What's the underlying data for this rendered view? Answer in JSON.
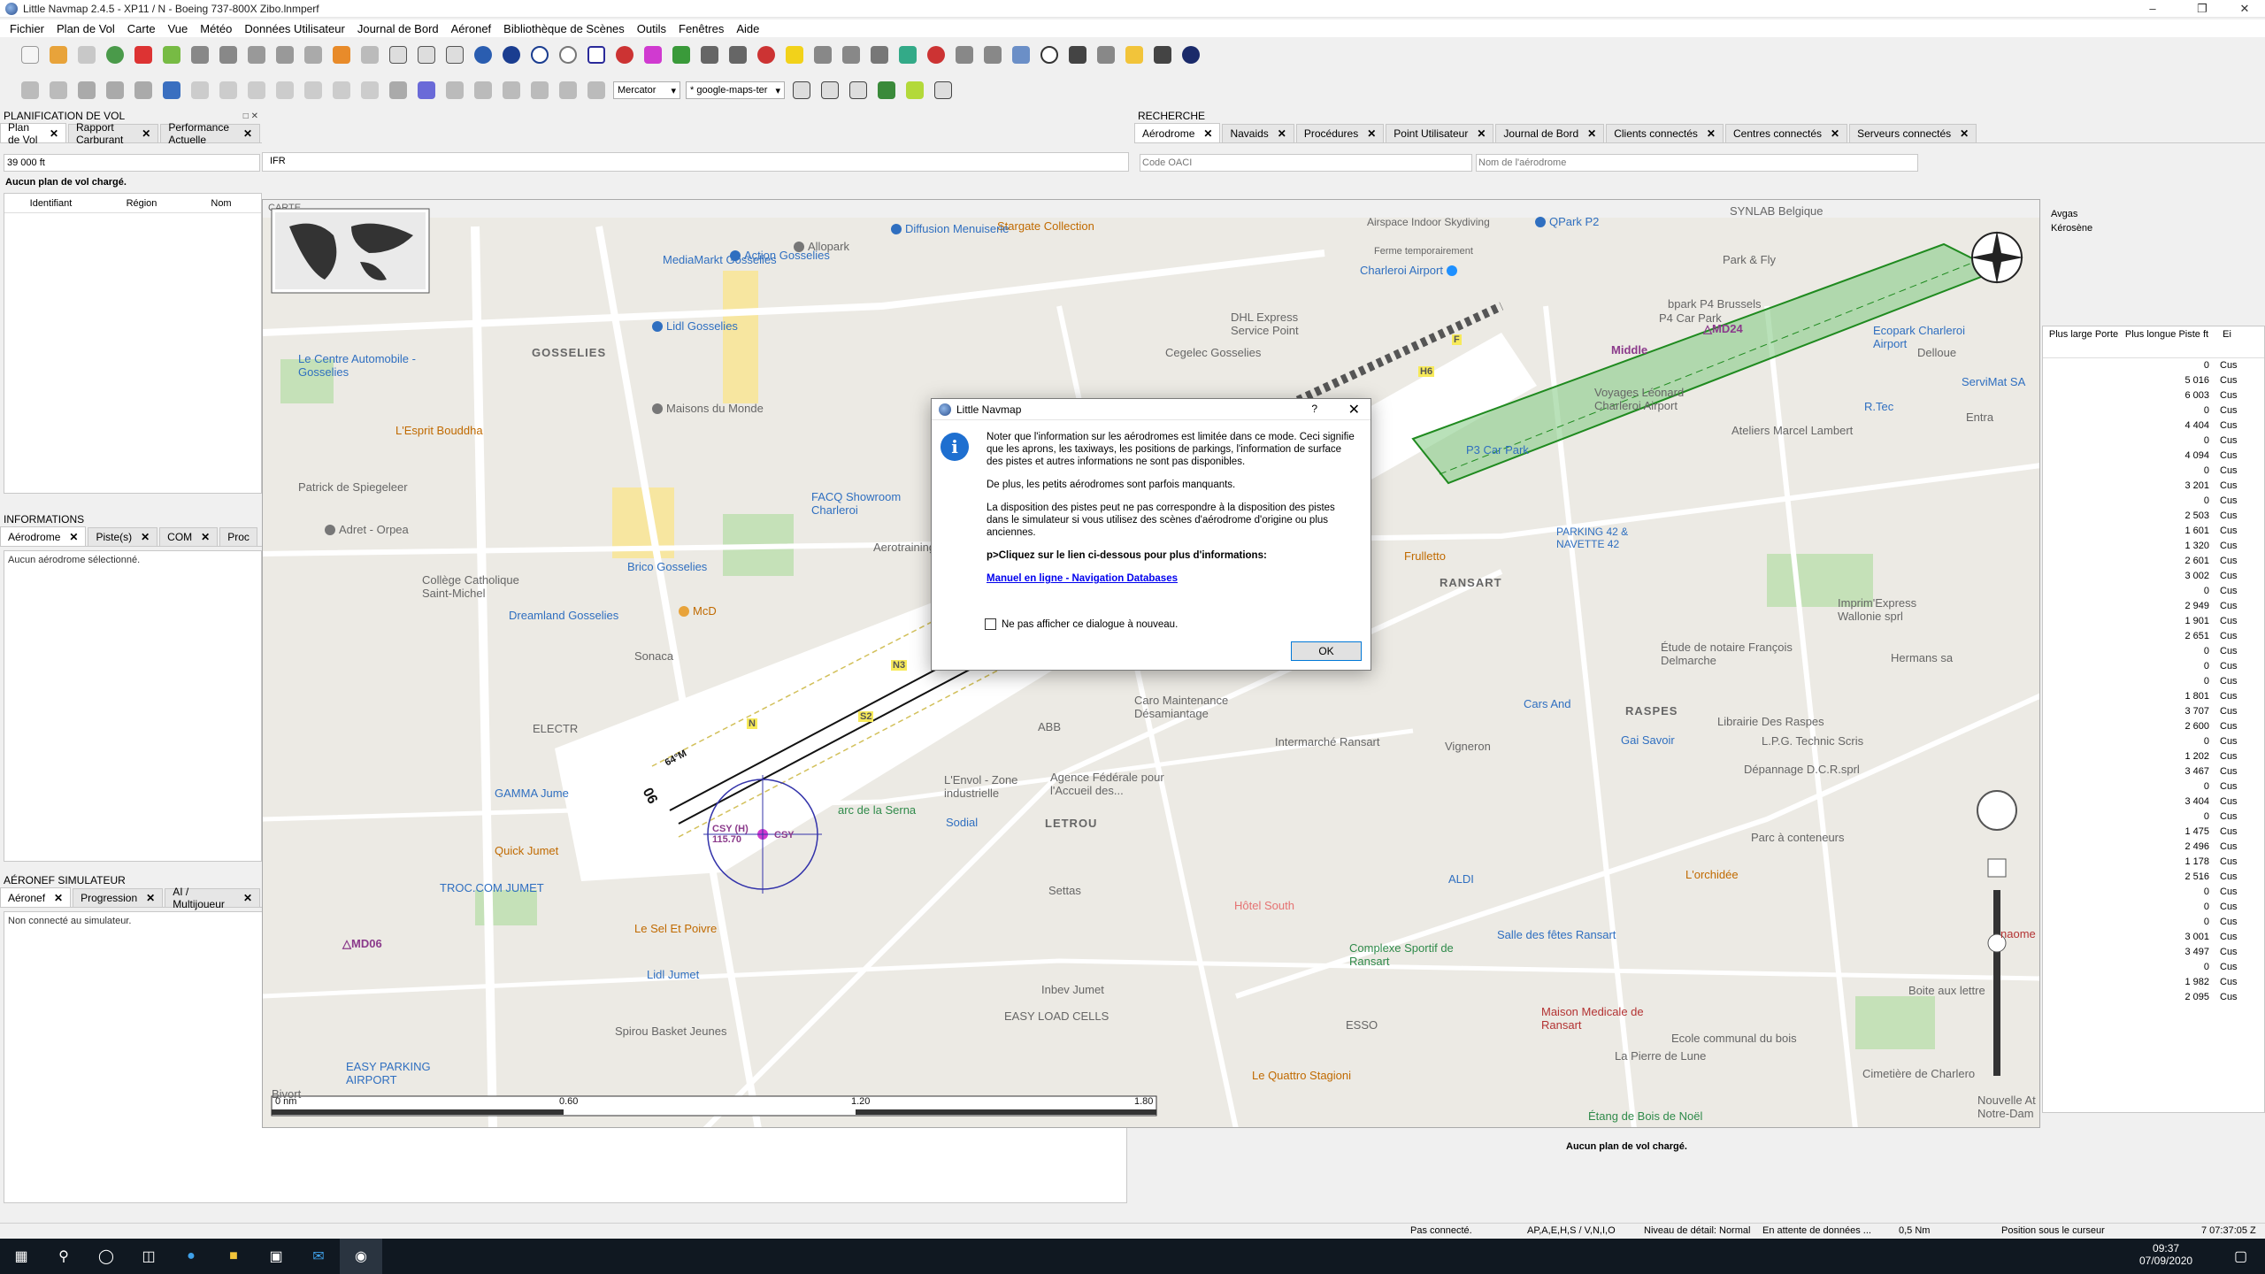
{
  "window": {
    "title": "Little Navmap 2.4.5 - XP11 / N - Boeing 737-800X Zibo.lnmperf"
  },
  "menu": [
    "Fichier",
    "Plan de Vol",
    "Carte",
    "Vue",
    "Météo",
    "Données Utilisateur",
    "Journal de Bord",
    "Aéronef",
    "Bibliothèque de Scènes",
    "Outils",
    "Fenêtres",
    "Aide"
  ],
  "toolbar": {
    "projection": "Mercator",
    "theme": "* google-maps-ter"
  },
  "flight_plan": {
    "title": "PLANIFICATION DE VOL",
    "tabs": [
      "Plan de Vol",
      "Rapport Carburant",
      "Performance Actuelle"
    ],
    "altitude": "39 000 ft",
    "type": "IFR",
    "no_plan": "Aucun plan de vol chargé.",
    "columns": [
      "Identifiant",
      "Région",
      "Nom"
    ]
  },
  "informations": {
    "title": "INFORMATIONS",
    "tabs": [
      "Aérodrome",
      "Piste(s)",
      "COM",
      "Proc"
    ],
    "empty": "Aucun aérodrome sélectionné."
  },
  "aircraft": {
    "title": "AÉRONEF SIMULATEUR",
    "tabs": [
      "Aéronef",
      "Progression",
      "AI / Multijoueur"
    ],
    "status": "Non connecté au simulateur."
  },
  "map": {
    "title": "CARTE",
    "scale_labels": [
      "0 nm",
      "0.60",
      "1.20",
      "1.80"
    ],
    "places": {
      "allopark": "Allopark",
      "action_gosselies": "Action Gosselies",
      "stargate": "Stargate Collection",
      "airspace": "Airspace Indoor Skydiving",
      "airspace_sub": "Ferme temporairement",
      "qpark": "QPark P2",
      "synlab": "SYNLAB Belgique",
      "diffusion": "Diffusion Menuiserie",
      "mediamarkt": "MediaMarkt Gosselies",
      "charleroi_airport": "Charleroi Airport",
      "bpark": "bpark P4 Brussels",
      "p4car": "P4 Car Park",
      "parkfly": "Park & Fly",
      "ecopark": "Ecopark Charleroi Airport",
      "delloue": "Delloue",
      "dhl": "DHL Express Service Point",
      "cegelec": "Cegelec Gosselies",
      "lidl_gosselies": "Lidl Gosselies",
      "gosselies": "GOSSELIES",
      "centre_auto": "Le Centre Automobile - Gosselies",
      "maisons_monde": "Maisons du Monde",
      "voyages": "Voyages Léonard Charleroi Airport",
      "ateliers": "Ateliers Marcel Lambert",
      "rtec": "R.Tec",
      "entra": "Entra",
      "servimat": "ServiMat SA",
      "esprit": "L'Esprit Bouddha",
      "p3car": "P3 Car Park",
      "patrick": "Patrick de Spiegeleer",
      "facq": "FACQ Showroom Charleroi",
      "aerotraining": "Aerotraining Netw",
      "adret": "Adret - Orpea",
      "brico": "Brico Gosselies",
      "college": "Collège Catholique Saint-Michel",
      "dreamland": "Dreamland Gosselies",
      "mcd": "McD",
      "sonaca": "Sonaca",
      "frulletto": "Frulletto",
      "parking42": "PARKING 42 & NAVETTE 42",
      "ransart": "RANSART",
      "imprim": "Imprim'Express Wallonie sprl",
      "etude": "Étude de notaire François Delmarche",
      "hermans": "Hermans sa",
      "electr": "ELECTR",
      "caro": "Caro Maintenance Désamiantage",
      "abb": "ABB",
      "cars_and": "Cars And",
      "raspes": "RASPES",
      "librairie": "Librairie Des Raspes",
      "intermarche": "Intermarché Ransart",
      "vigneron": "Vigneron",
      "gai_savoir": "Gai Savoir",
      "lpg": "L.P.G. Technic Scris",
      "depannage": "Dépannage D.C.R.sprl",
      "gamma": "GAMMA Jume",
      "lenvol": "L'Envol - Zone industrielle",
      "agence": "Agence Fédérale pour l'Accueil des...",
      "serna": "arc de la Serna",
      "sodial": "Sodial",
      "letrou": "LETROU",
      "parc_cont": "Parc à conteneurs",
      "orchidee": "L'orchidée",
      "quick": "Quick Jumet",
      "troc": "TROC.COM JUMET",
      "aldi": "ALDI",
      "settas": "Settas",
      "hotel_south": "Hôtel South",
      "sel_poivre": "Le Sel Et Poivre",
      "complexe": "Complexe Sportif de Ransart",
      "salle_fetes": "Salle des fêtes Ransart",
      "lidl_jumet": "Lidl Jumet",
      "inbev": "Inbev Jumet",
      "easy_cells": "EASY LOAD CELLS",
      "maison_med": "Maison Medicale de Ransart",
      "boite": "Boite aux lettre",
      "spirou": "Spirou Basket Jeunes",
      "esso": "ESSO",
      "ecole": "Ecole communal du bois",
      "easy_park": "EASY PARKING AIRPORT",
      "pierre_lune": "La Pierre de Lune",
      "cimetiere": "Cimetière de Charlero",
      "quattro": "Le Quattro Stagioni",
      "etang": "Étang de Bois de Noël",
      "nouvelle": "Nouvelle At Notre-Dam",
      "bivort": "Bivort",
      "naome": "naome",
      "mid24": "MD24",
      "md06": "MD06",
      "middle": "Middle",
      "csy": "CSY (H) 115.70",
      "csy2": "CSY",
      "rwy06": "06",
      "h6": "H6",
      "n3": "N3",
      "s2": "S2",
      "n": "N",
      "f": "F",
      "hdg": "64°M"
    }
  },
  "dialog": {
    "title": "Little Navmap",
    "help": "?",
    "para1": "Noter que l'information sur les aérodromes est limitée dans ce mode. Ceci signifie que les aprons, les taxiways, les positions de parkings, l'information de surface des pistes et autres informations ne sont pas disponibles.",
    "para2": "De plus, les petits aérodromes sont parfois manquants.",
    "para3": "La disposition des pistes peut ne pas correspondre à la disposition des pistes dans le simulateur si vous utilisez des scènes d'aérodrome d'origine ou plus anciennes.",
    "para4": "p>Cliquez sur le lien ci-dessous pour plus d'informations:",
    "link": "Manuel en ligne - Navigation Databases",
    "checkbox": "Ne pas afficher ce dialogue à nouveau.",
    "ok": "OK"
  },
  "search": {
    "title": "RECHERCHE",
    "tabs": [
      "Aérodrome",
      "Navaids",
      "Procédures",
      "Point Utilisateur",
      "Journal de Bord",
      "Clients connectés",
      "Centres connectés",
      "Serveurs connectés"
    ],
    "icao_placeholder": "Code OACI",
    "name_placeholder": "Nom de l'aérodrome",
    "fuel": [
      "Avgas",
      "Kérosène"
    ],
    "col_wide": "Plus large Porte",
    "col_long": "Plus longue Piste ft",
    "col_e": "Ei",
    "lengths": [
      "0",
      "5 016",
      "6 003",
      "0",
      "4 404",
      "0",
      "4 094",
      "0",
      "3 201",
      "0",
      "2 503",
      "1 601",
      "1 320",
      "2 601",
      "3 002",
      "0",
      "2 949",
      "1 901",
      "2 651",
      "0",
      "0",
      "0",
      "1 801",
      "3 707",
      "2 600",
      "0",
      "1 202",
      "3 467",
      "0",
      "3 404",
      "0",
      "1 475",
      "2 496",
      "1 178",
      "2 516",
      "0",
      "0",
      "0",
      "3 001",
      "3 497",
      "0",
      "1 982",
      "2 095"
    ],
    "cus": "Cus"
  },
  "bottom_right": {
    "no_plan": "Aucun plan de vol chargé."
  },
  "status": {
    "connection": "Pas connecté.",
    "filter": "AP,A,E,H,S / V,N,I,O",
    "detail": "Niveau de détail: Normal",
    "waiting": "En attente de données ...",
    "dist": "0,5 Nm",
    "pos": "Position sous le curseur",
    "time": "7  07:37:05 Z"
  },
  "taskbar": {
    "time": "09:37",
    "date": "07/09/2020"
  }
}
